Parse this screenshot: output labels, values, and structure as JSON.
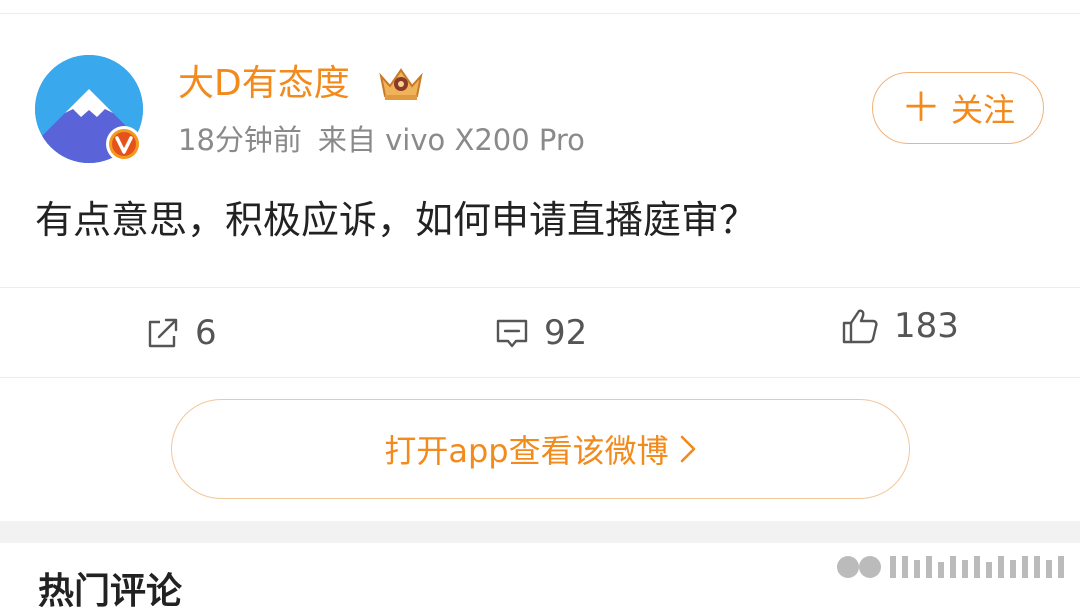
{
  "post": {
    "author": "大D有态度",
    "time": "18分钟前",
    "source": "来自 vivo X200 Pro",
    "follow_label": "关注",
    "text": "有点意思，积极应诉，如何申请直播庭审？"
  },
  "actions": {
    "share_count": "6",
    "comment_count": "92",
    "like_count": "183"
  },
  "open_app_label": "打开app查看该微博",
  "section_title": "热门评论",
  "colors": {
    "accent": "#f28a1c",
    "border_accent": "#f2b27a",
    "text": "#222222",
    "meta": "#8a8a8a"
  },
  "icons": [
    "share-icon",
    "comment-icon",
    "like-icon",
    "plus-icon",
    "chevron-right-icon",
    "crown-icon",
    "verified-v-icon"
  ]
}
